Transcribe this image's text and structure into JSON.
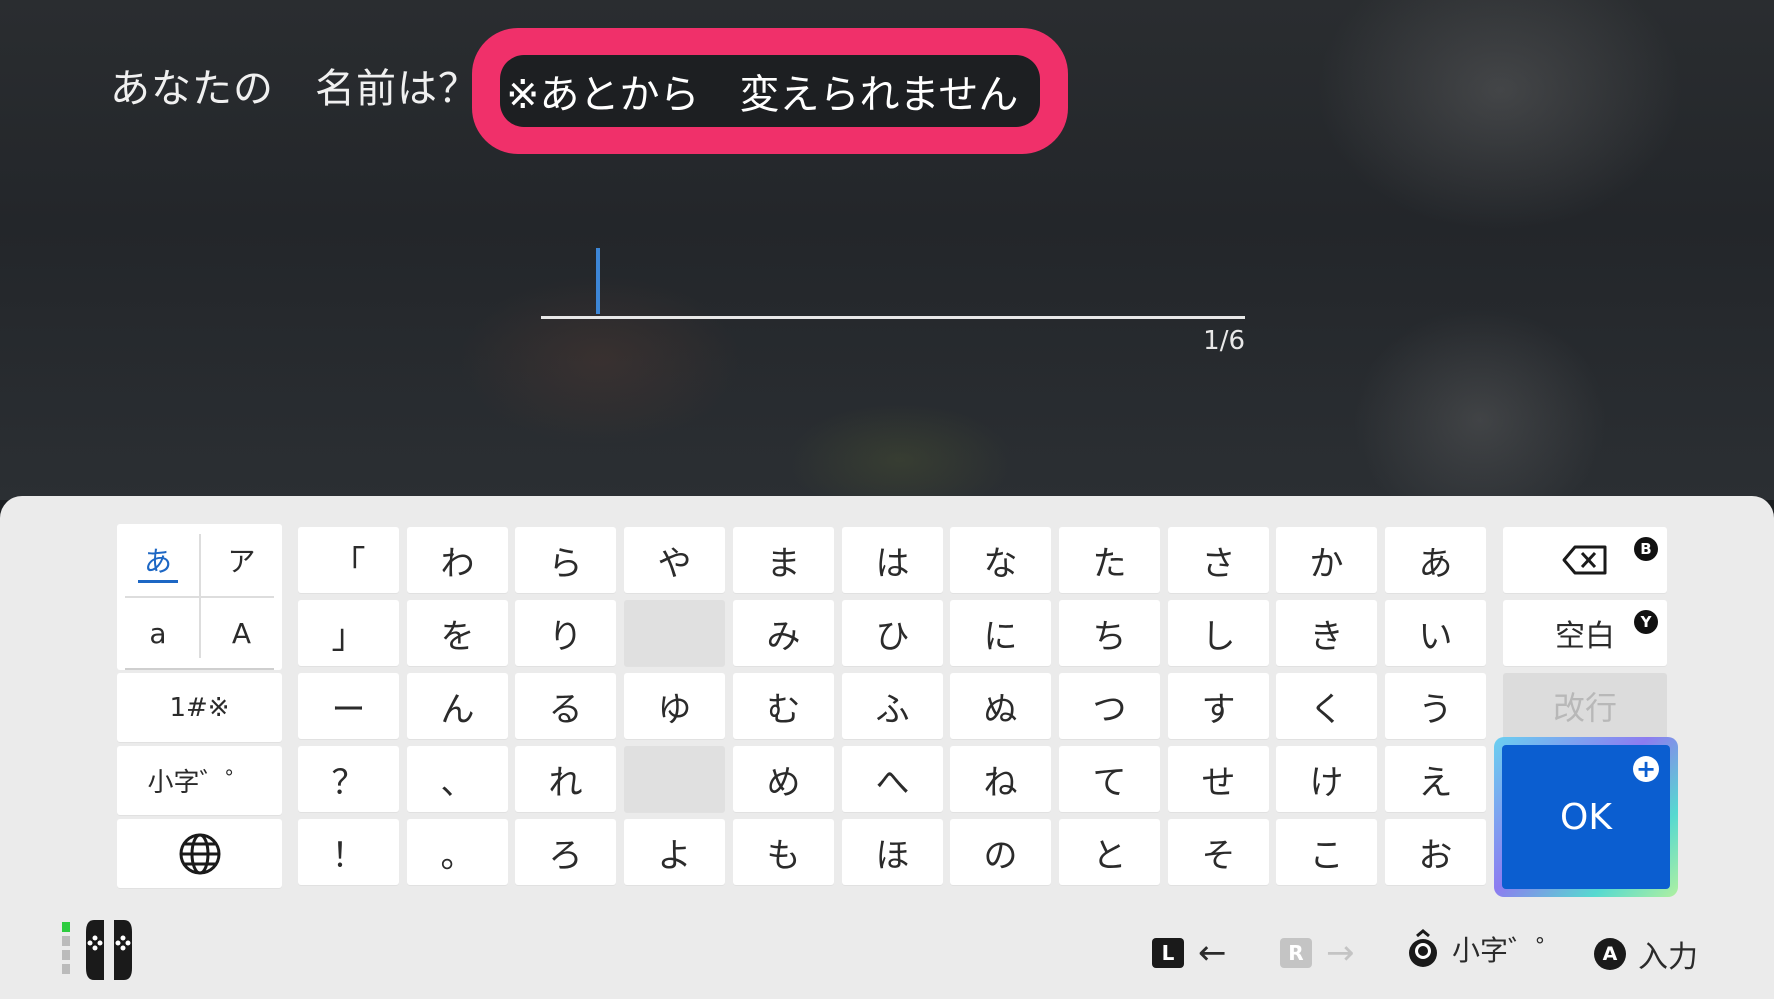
{
  "prompt": {
    "title": "あなたの　名前は？",
    "warning": "※あとから　変えられません"
  },
  "input": {
    "value": "",
    "counter": "1/6"
  },
  "mode_keys": {
    "hiragana": "あ",
    "katakana": "ア",
    "lower_latin": "a",
    "upper_latin": "A",
    "symbols": "1#※",
    "small_char": "小字゛゜",
    "globe_icon": "globe-icon"
  },
  "key_columns": [
    [
      "「",
      "」",
      "ー",
      "？",
      "！"
    ],
    [
      "わ",
      "を",
      "ん",
      "、",
      "。"
    ],
    [
      "ら",
      "り",
      "る",
      "れ",
      "ろ"
    ],
    [
      "や",
      "",
      "ゆ",
      "",
      "よ"
    ],
    [
      "ま",
      "み",
      "む",
      "め",
      "も"
    ],
    [
      "は",
      "ひ",
      "ふ",
      "へ",
      "ほ"
    ],
    [
      "な",
      "に",
      "ぬ",
      "ね",
      "の"
    ],
    [
      "た",
      "ち",
      "つ",
      "て",
      "と"
    ],
    [
      "さ",
      "し",
      "す",
      "せ",
      "そ"
    ],
    [
      "か",
      "き",
      "く",
      "け",
      "こ"
    ],
    [
      "あ",
      "い",
      "う",
      "え",
      "お"
    ]
  ],
  "actions": {
    "backspace_icon": "backspace-icon",
    "backspace_badge": "B",
    "space": "空白",
    "space_badge": "Y",
    "newline": "改行",
    "ok": "OK",
    "ok_badge": "+"
  },
  "footer": {
    "l_button": "L",
    "r_button": "R",
    "left_arrow": "←",
    "right_arrow": "→",
    "small_char": "小字゛゜",
    "a_button": "A",
    "input_label": "入力"
  },
  "colors": {
    "warning_highlight": "#f0306a",
    "ok_key": "#0b5ed0",
    "cursor": "#3d86d6"
  }
}
